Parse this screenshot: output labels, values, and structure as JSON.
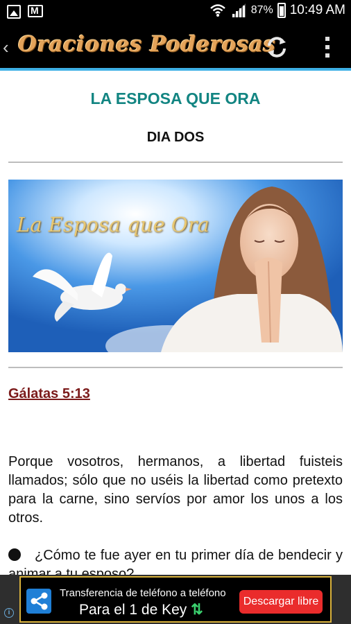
{
  "status_bar": {
    "battery": "87%",
    "time": "10:49 AM"
  },
  "action_bar": {
    "title": "Oraciones Poderosas"
  },
  "content": {
    "heading": "LA ESPOSA QUE ORA",
    "subheading": "DIA DOS",
    "hero_text": "La Esposa que Ora",
    "scripture": "Gálatas 5:13",
    "verse": "Porque vosotros, hermanos, a libertad fuisteis llamados; sólo que no uséis la libertad como pretexto para la carne, sino servíos por amor los unos a los otros.",
    "question": "¿Cómo te fue ayer en tu primer día de bendecir y animar a tu esposo?"
  },
  "ad": {
    "info": "i",
    "line1": "Transferencia de teléfono a teléfono",
    "line2": "Para el 1 de Key",
    "arrows": "⇅",
    "cta": "Descargar libre"
  },
  "colors": {
    "heading": "#138582",
    "scripture": "#7b1a1a",
    "accent_line": "#3fb0e6",
    "ad_cta": "#ea2c2c"
  }
}
